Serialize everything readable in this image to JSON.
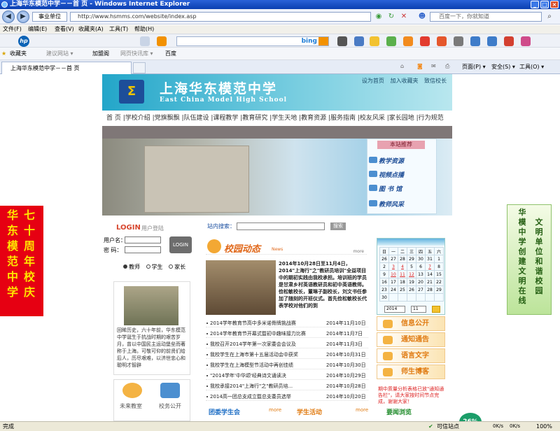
{
  "window": {
    "title": "上海华东模范中学－－首  页 - Windows Internet Explorer"
  },
  "navbar": {
    "zone": "事业单位",
    "url": "http://www.hsmms.com/website/index.asp",
    "search_placeholder": "百度一下，你就知道"
  },
  "menu": [
    "文件(F)",
    "编辑(E)",
    "查看(V)",
    "收藏夹(A)",
    "工具(T)",
    "帮助(H)"
  ],
  "favorites": {
    "label": "收藏夹",
    "items": [
      "建议网站 ▾",
      "加盟阁",
      "网页快讯库 ▾",
      "百度"
    ]
  },
  "tab": {
    "title": "上海华东模范中学－－首  页",
    "commands": [
      "页面(P) ▾",
      "安全(S) ▾",
      "工具(O) ▾"
    ]
  },
  "header": {
    "logo_cn": "上海华东模范中学",
    "logo_en": "East China Model High School",
    "links": [
      "设为首页",
      "加入收藏夹",
      "致信校长"
    ]
  },
  "mainnav": "首  页 |学校介绍 |党旗飘飘 |队伍建设 |课程教学 |教育研究 |学生天地 |教育资源 |服务指南 |校友风采 |家长园地 |行为规范",
  "banner_panel": {
    "title": "本站推荐",
    "items": [
      "教学资源",
      "视频点播",
      "图 书 馆",
      "教师风采"
    ]
  },
  "login": {
    "title": "LOGIN",
    "subtitle": "用户登陆",
    "user_label": "用户名：",
    "pass_label": "密  码：",
    "button": "LOGIN",
    "roles": [
      "教师",
      "学生",
      "家长"
    ]
  },
  "history": {
    "text": "回眸历史，六十年前，华东模范中学诞生于抗战时期的艰苦岁月，曾以中国民主运动堡垒而著称于上海。可敬可仰的前贤们给后人，历尽艰难，以济世忠心和聪明才智辟"
  },
  "bottom_icons": [
    "未来教室",
    "校务公开"
  ],
  "site_search": {
    "label": "站内搜索：",
    "button": "搜索"
  },
  "news": {
    "title": "校园动态",
    "title_en": "News",
    "more": "more",
    "featured": "2014年10月28日至11月4日，2014\"上海行\"之\"教研员培训\"全益项目中的期初实践由我校承担。培训班的学员是甘肃乡村英语教研员和初中英语教师。俭松敏校长，董琳子副校长，刘文书任参加了随刻的开班仪式。首先俭松敏校长代表学校对他们的到",
    "items": [
      {
        "text": "2014学年教育节高中多米诺骨牌挑战赛",
        "date": "2014年11月10日"
      },
      {
        "text": "2014学年教育节开幕式暨初中趣味接力比赛",
        "date": "2014年11月7日"
      },
      {
        "text": "我校召开2014学年第一次家委会会议及",
        "date": "2014年11月3日"
      },
      {
        "text": "我校学生在上海市第十五届活动会中获奖",
        "date": "2014年10月31日"
      },
      {
        "text": "我校学生在上海模型节活动中再创佳绩",
        "date": "2014年10月30日"
      },
      {
        "text": "\"2014学年'中华颂'经典诗文诵读决",
        "date": "2014年10月29日"
      },
      {
        "text": "我校承接2014\"上海行\"之\"教研员培...",
        "date": "2014年10月28日"
      },
      {
        "text": "2014高一团总支成立暨总支委员选举",
        "date": "2014年10月20日"
      }
    ]
  },
  "lower_titles": [
    "团委学生会",
    "学生活动",
    "要闻浏览"
  ],
  "lower_more": [
    "more",
    "more",
    "more"
  ],
  "calendar": {
    "weekdays": [
      "日",
      "一",
      "二",
      "三",
      "四",
      "五",
      "六"
    ],
    "rows": [
      [
        "26",
        "27",
        "28",
        "29",
        "30",
        "31",
        "1"
      ],
      [
        "2",
        "3",
        "4",
        "5",
        "6",
        "7",
        "8"
      ],
      [
        "9",
        "10",
        "11",
        "12",
        "13",
        "14",
        "15"
      ],
      [
        "16",
        "17",
        "18",
        "19",
        "20",
        "21",
        "22"
      ],
      [
        "23",
        "24",
        "25",
        "26",
        "27",
        "28",
        "29"
      ],
      [
        "30",
        "",
        "",
        "",
        "",
        "",
        ""
      ]
    ],
    "year": "2014",
    "month": "11"
  },
  "quicklinks": [
    "信息公开",
    "通知通告",
    "语言文字",
    "师生博客"
  ],
  "notice": "期中质量分析表格已放\"通知通告栏\"，请大家按时间节点完成，谢谢大家！",
  "side_left": [
    "华东模范中学",
    "七十周年校庆"
  ],
  "side_right": [
    "华模中学创建文明在线",
    "文明单位和谐校园"
  ],
  "statusbar": {
    "left": "完成",
    "zone": "可信站点",
    "zoom": "100%",
    "cpu": "26%",
    "net_up": "0K/s",
    "net_down": "0K/s"
  },
  "colors": {
    "titlebar": "#0a3fb0",
    "header": "#23a6c9",
    "accent_orange": "#e0681a",
    "side_left_bg": "#e60012",
    "side_left_text": "#ffe400"
  }
}
